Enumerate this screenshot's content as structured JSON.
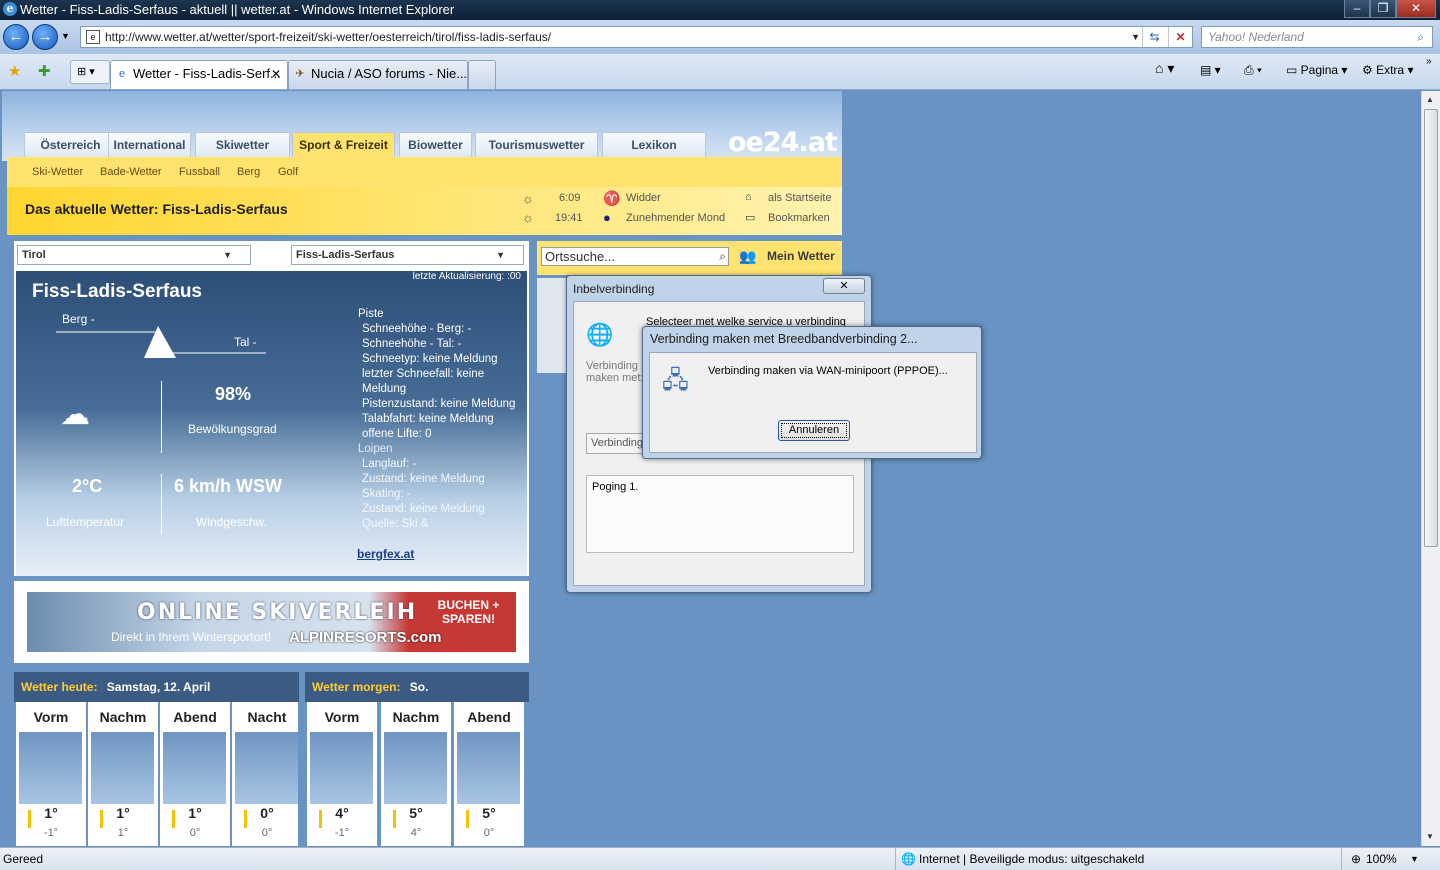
{
  "window": {
    "title": "Wetter - Fiss-Ladis-Serfaus - aktuell || wetter.at - Windows Internet Explorer",
    "controls": [
      "–",
      "❐",
      "✕"
    ]
  },
  "nav": {
    "url": "http://www.wetter.at/wetter/sport-freizeit/ski-wetter/oesterreich/tirol/fiss-ladis-serfaus/",
    "search_placeholder": "Yahoo! Nederland"
  },
  "tabs": [
    {
      "label": "Wetter - Fiss-Ladis-Serf...",
      "active": true
    },
    {
      "label": "Nucia / ASO forums - Nie...",
      "active": false
    }
  ],
  "commandbar": {
    "page": "Pagina",
    "extra": "Extra"
  },
  "site": {
    "main_tabs": [
      "Österreich",
      "International",
      "Skiwetter",
      "Sport & Freizeit",
      "Biowetter",
      "Tourismuswetter",
      "Lexikon"
    ],
    "logo": "oe24.at",
    "sub_tabs": [
      "Ski-Wetter",
      "Bade-Wetter",
      "Fussball",
      "Berg",
      "Golf"
    ],
    "headline": "Das aktuelle Wetter: Fiss-Ladis-Serfaus",
    "sunrise": "6:09",
    "sunset": "19:41",
    "zodiac": "Widder",
    "moon": "Zunehmender Mond",
    "startpage": "als Startseite",
    "bookmarks": "Bookmarken",
    "region_select": "Tirol",
    "place_select": "Fiss-Ladis-Serfaus",
    "search_placeholder": "Ortssuche...",
    "my_weather": "Mein Wetter",
    "last_update": "letzte Aktualisierung: :00",
    "location": "Fiss-Ladis-Serfaus",
    "berg_label": "Berg  -",
    "tal_label": "Tal  -",
    "cloud_pct": "98%",
    "cloud_label": "Bewölkungsgrad",
    "temp": "2°C",
    "temp_label": "Lufttemperatur",
    "wind": "6 km/h WSW",
    "wind_label": "Windgeschw.",
    "piste_title": "Piste",
    "piste_lines": [
      "Schneehöhe - Berg:  -",
      "Schneehöhe - Tal:  -",
      "Schneetyp: keine Meldung",
      "letzter Schneefall: keine Meldung",
      "Pistenzustand: keine Meldung",
      "Talabfahrt: keine Meldung",
      "offene Lifte: 0"
    ],
    "loipen_title": "Loipen",
    "loipen_lines": [
      "Langlauf:  -",
      "Zustand: keine Meldung",
      "Skating:  -",
      "Zustand: keine Meldung",
      "Quelle: Ski &"
    ],
    "source_link": "bergfex.at",
    "ad": {
      "line1": "ONLINE SKIVERLEIH",
      "line2": "Direkt in Ihrem Wintersportort!",
      "brand": "ALPINRESORTS.com",
      "badge": "BUCHEN + SPAREN!"
    },
    "today_label": "Wetter heute:",
    "today_date": "Samstag, 12. April",
    "tomorrow_label": "Wetter morgen:",
    "tomorrow_date": "So.",
    "forecast": [
      {
        "name": "Vorm",
        "hi": "1°",
        "lo": "-1°"
      },
      {
        "name": "Nachm",
        "hi": "1°",
        "lo": "1°"
      },
      {
        "name": "Abend",
        "hi": "1°",
        "lo": "0°"
      },
      {
        "name": "Nacht",
        "hi": "0°",
        "lo": "0°"
      },
      {
        "name": "Vorm",
        "hi": "4°",
        "lo": "-1°"
      },
      {
        "name": "Nachm",
        "hi": "5°",
        "lo": "4°"
      },
      {
        "name": "Abend",
        "hi": "5°",
        "lo": "0°"
      }
    ]
  },
  "dialog_back": {
    "title": "Inbelverbinding",
    "close": "✕",
    "prompt": "Selecteer met welke service u verbinding",
    "connect_label": "Verbinding maken met:",
    "field_value": "Verbinding",
    "log": "Poging 1."
  },
  "dialog_front": {
    "title": "Verbinding maken met Breedbandverbinding 2...",
    "message": "Verbinding maken via WAN-minipoort (PPPOE)...",
    "cancel": "Annuleren"
  },
  "status": {
    "text": "Gereed",
    "zone": "Internet | Beveiligde modus: uitgeschakeld",
    "zoom": "100%"
  }
}
